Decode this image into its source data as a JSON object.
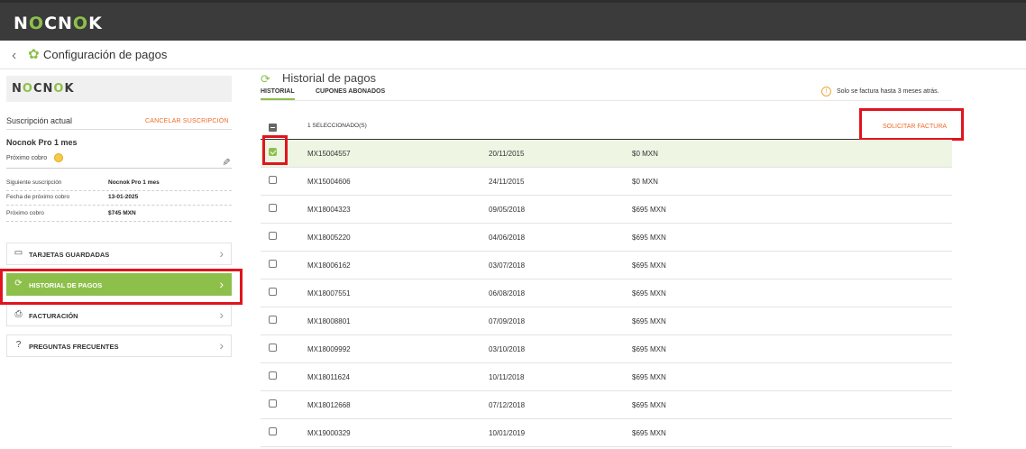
{
  "header": {
    "logo": "NOCNOK"
  },
  "subheader": {
    "back": "‹",
    "title": "Configuración de pagos",
    "icon": "gear-icon"
  },
  "sidebar": {
    "logo": "NOCNOK",
    "subscription_label": "Suscripción actual",
    "cancel_label": "CANCELAR SUSCRIPCIÓN",
    "plan_name": "Nocnok Pro 1 mes",
    "next_charge_label": "Próximo cobro",
    "details": [
      {
        "key": "Siguiente suscripción",
        "value": "Nocnok Pro 1 mes"
      },
      {
        "key": "Fecha de próximo cobro",
        "value": "13-01-2025"
      },
      {
        "key": "Próximo cobro",
        "value": "$745 MXN"
      }
    ],
    "menu": [
      {
        "label": "TARJETAS GUARDADAS",
        "icon": "card-icon",
        "glyph": "▭"
      },
      {
        "label": "HISTORIAL DE PAGOS",
        "icon": "history-icon",
        "glyph": "⟳"
      },
      {
        "label": "FACTURACIÓN",
        "icon": "invoice-icon",
        "glyph": "⎙"
      },
      {
        "label": "PREGUNTAS FRECUENTES",
        "icon": "question-icon",
        "glyph": "?"
      }
    ],
    "chevron": "›"
  },
  "main": {
    "title": "Historial de pagos",
    "tabs": [
      {
        "label": "HISTORIAL"
      },
      {
        "label": "CUPONES ABONADOS"
      }
    ],
    "info_text": "Solo se factura hasta 3 meses atrás.",
    "info_glyph": "!",
    "selected_count": "1 SELECCIONADO(S)",
    "invoice_button": "SOLICITAR FACTURA",
    "rows": [
      {
        "id": "MX15004557",
        "date": "20/11/2015",
        "amount": "$0 MXN",
        "checked": true
      },
      {
        "id": "MX15004606",
        "date": "24/11/2015",
        "amount": "$0 MXN",
        "checked": false
      },
      {
        "id": "MX18004323",
        "date": "09/05/2018",
        "amount": "$695 MXN",
        "checked": false
      },
      {
        "id": "MX18005220",
        "date": "04/06/2018",
        "amount": "$695 MXN",
        "checked": false
      },
      {
        "id": "MX18006162",
        "date": "03/07/2018",
        "amount": "$695 MXN",
        "checked": false
      },
      {
        "id": "MX18007551",
        "date": "06/08/2018",
        "amount": "$695 MXN",
        "checked": false
      },
      {
        "id": "MX18008801",
        "date": "07/09/2018",
        "amount": "$695 MXN",
        "checked": false
      },
      {
        "id": "MX18009992",
        "date": "03/10/2018",
        "amount": "$695 MXN",
        "checked": false
      },
      {
        "id": "MX18011624",
        "date": "10/11/2018",
        "amount": "$695 MXN",
        "checked": false
      },
      {
        "id": "MX18012668",
        "date": "07/12/2018",
        "amount": "$695 MXN",
        "checked": false
      },
      {
        "id": "MX19000329",
        "date": "10/01/2019",
        "amount": "$695 MXN",
        "checked": false
      }
    ]
  },
  "colors": {
    "brand_green": "#8dc04b",
    "accent_orange": "#f06a2a",
    "highlight_red": "#e0141e",
    "topbar": "#3a3b3a"
  }
}
